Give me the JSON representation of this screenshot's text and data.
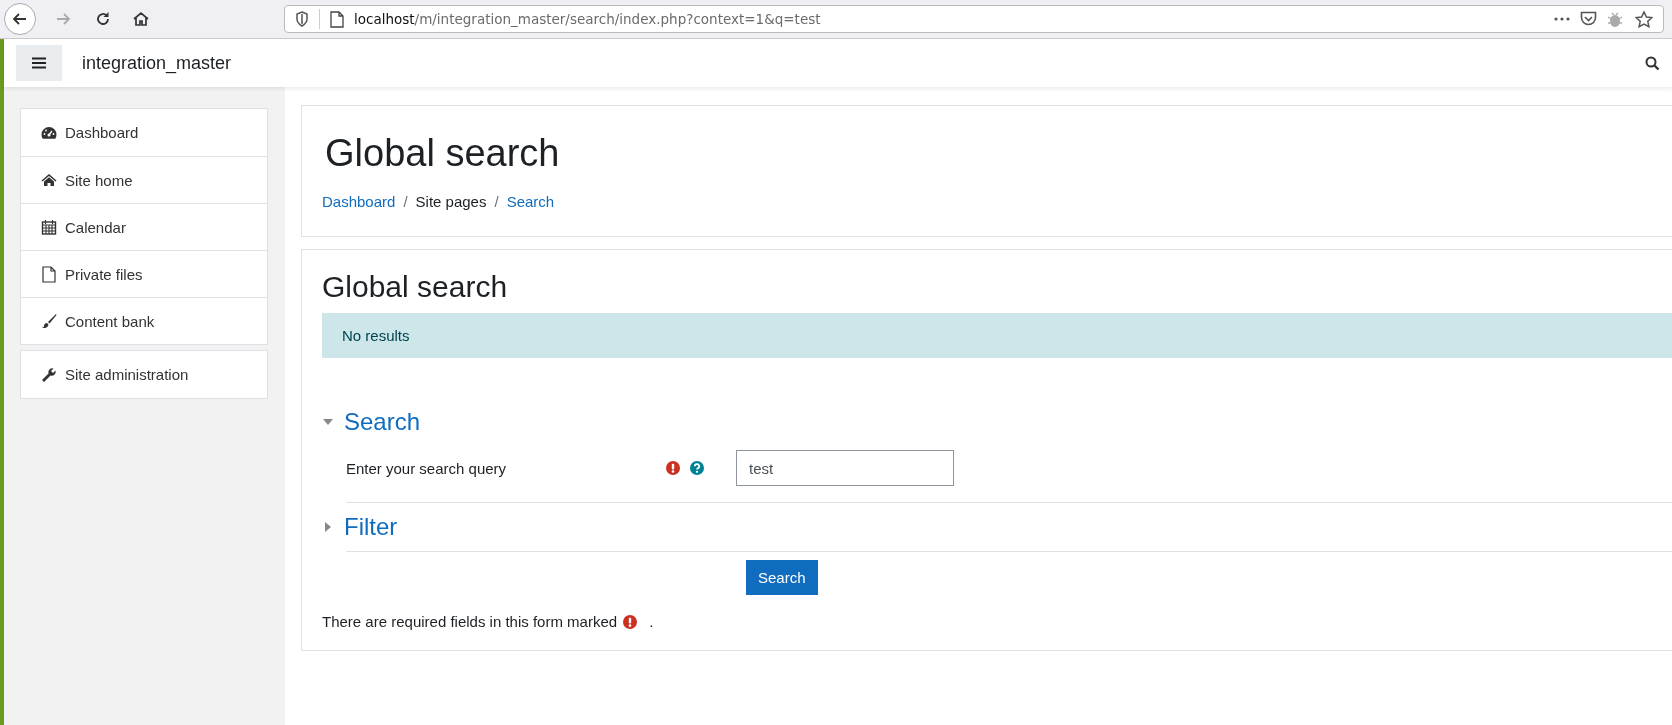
{
  "browser": {
    "url_host": "localhost",
    "url_path": "/m/integration_master/search/index.php?context=1&q=test"
  },
  "navbar": {
    "site_name": "integration_master"
  },
  "sidebar": {
    "sections": [
      {
        "items": [
          {
            "label": "Dashboard",
            "kind": "dashboard"
          },
          {
            "label": "Site home",
            "kind": "home"
          },
          {
            "label": "Calendar",
            "kind": "calendar"
          },
          {
            "label": "Private files",
            "kind": "file"
          },
          {
            "label": "Content bank",
            "kind": "brush"
          }
        ]
      },
      {
        "items": [
          {
            "label": "Site administration",
            "kind": "wrench"
          }
        ]
      }
    ]
  },
  "header": {
    "title": "Global search",
    "separator": "/",
    "breadcrumb": [
      {
        "label": "Dashboard",
        "link": true
      },
      {
        "label": "Site pages",
        "link": false
      },
      {
        "label": "Search",
        "link": true
      }
    ]
  },
  "content": {
    "title": "Global search",
    "notice": "No results",
    "fieldsets": [
      {
        "legend": "Search",
        "expanded": true,
        "fields": [
          {
            "label": "Enter your search query",
            "required": true,
            "help": true,
            "value": "test"
          }
        ]
      },
      {
        "legend": "Filter",
        "expanded": false
      }
    ],
    "submit": "Search",
    "required_note": "There are required fields in this form marked",
    "required_note_end": "."
  }
}
